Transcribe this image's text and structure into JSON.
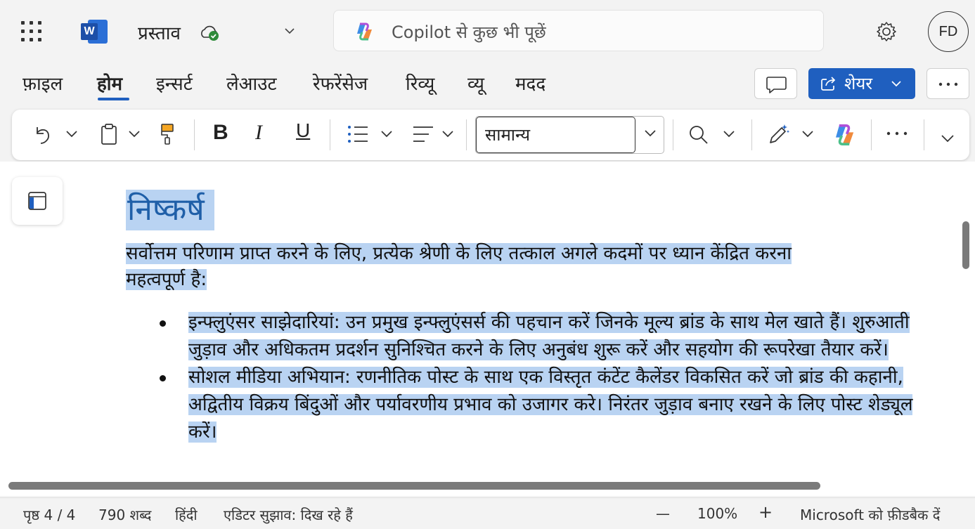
{
  "app": {
    "doc_title": "प्रस्ताव",
    "app_logo_letter": "W"
  },
  "search": {
    "placeholder": "Copilot से कुछ भी पूछें"
  },
  "user": {
    "initials": "FD"
  },
  "tabs": [
    {
      "label": "फ़ाइल"
    },
    {
      "label": "होम"
    },
    {
      "label": "इन्सर्ट"
    },
    {
      "label": "लेआउट"
    },
    {
      "label": "रेफरेंसेज"
    },
    {
      "label": "रिव्यू"
    },
    {
      "label": "व्यू"
    },
    {
      "label": "मदद"
    }
  ],
  "share": {
    "label": "शेयर"
  },
  "ribbon": {
    "style_value": "सामान्य",
    "bold": "B",
    "italic": "I",
    "underline": "U",
    "more": "···"
  },
  "document": {
    "heading": "निष्कर्ष",
    "intro_line1": "सर्वोत्तम परिणाम प्राप्त करने के लिए, प्रत्येक श्रेणी के लिए तत्काल अगले कदमों पर ध्यान केंद्रित करना",
    "intro_line2": "महत्वपूर्ण है:",
    "bullets": [
      {
        "text": "इन्फ्लुएंसर साझेदारियां: उन प्रमुख इन्फ्लुएंसर्स की पहचान करें जिनके मूल्य ब्रांड के साथ मेल खाते हैं। शुरुआती जुड़ाव और अधिकतम प्रदर्शन सुनिश्चित करने के लिए अनुबंध शुरू करें और सहयोग की रूपरेखा तैयार करें।"
      },
      {
        "text": "सोशल मीडिया अभियान: रणनीतिक पोस्ट के साथ एक विस्तृत कंटेंट कैलेंडर विकसित करें जो ब्रांड की कहानी, अद्वितीय विक्रय बिंदुओं और पर्यावरणीय प्रभाव को उजागर करे। निरंतर जुड़ाव बनाए रखने के लिए पोस्ट शेड्यूल करें।"
      }
    ]
  },
  "status": {
    "page": "पृष्ठ 4 / 4",
    "words": "790 शब्द",
    "language": "हिंदी",
    "editor": "एडिटर सुझाव: दिख रहे हैं",
    "zoom_minus": "—",
    "zoom": "100%",
    "zoom_plus": "+",
    "feedback": "Microsoft को फ़ीडबैक दें"
  },
  "colors": {
    "accent": "#1f5fbf",
    "selection": "#b9d3f2",
    "heading": "#1f5fa8"
  }
}
